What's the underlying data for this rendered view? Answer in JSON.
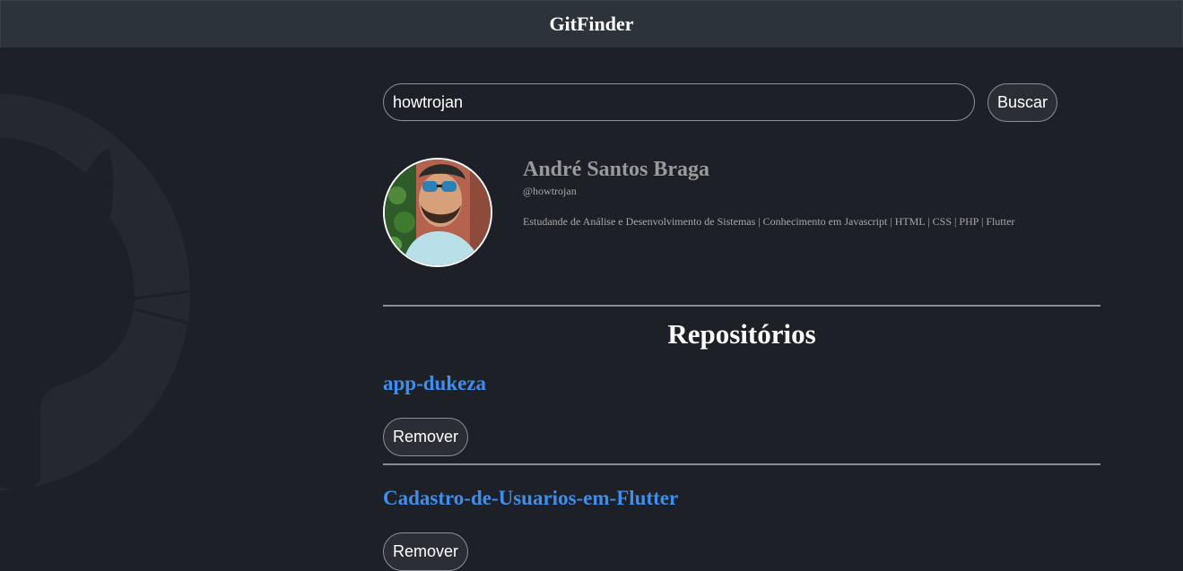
{
  "app": {
    "title": "GitFinder"
  },
  "search": {
    "value": "howtrojan",
    "button_label": "Buscar"
  },
  "profile": {
    "name": "André Santos Braga",
    "login": "@howtrojan",
    "bio": "Estudande de Análise e Desenvolvimento de Sistemas | Conhecimento em Javascript | HTML | CSS | PHP | Flutter"
  },
  "repos": {
    "title": "Repositórios",
    "items": [
      {
        "name": "app-dukeza",
        "remove_label": "Remover"
      },
      {
        "name": "Cadastro-de-Usuarios-em-Flutter",
        "remove_label": "Remover"
      }
    ]
  },
  "colors": {
    "background": "#1d2026",
    "header": "#2d333b",
    "link": "#3d8ef0",
    "muted": "#9a9a9a"
  }
}
